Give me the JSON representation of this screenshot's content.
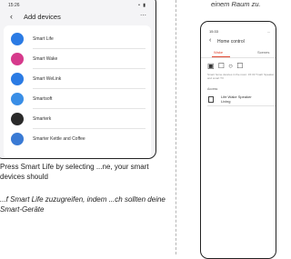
{
  "caption_top": "einem Raum zu.",
  "phone1": {
    "status_time": "15:26",
    "status_icons": "• ▮",
    "back_glyph": "‹",
    "title": "Add devices",
    "more_glyph": "⋯",
    "items": [
      {
        "label": "Smart Life",
        "color": "#2b7be4",
        "icon": "smart-life-icon"
      },
      {
        "label": "Smart Wake",
        "color": "#d63a8c",
        "icon": "smart-wake-icon"
      },
      {
        "label": "Smart WeLink",
        "color": "#2b7be4",
        "icon": "welink-icon"
      },
      {
        "label": "Smartsoft",
        "color": "#3a8ee6",
        "icon": "smartsoft-icon"
      },
      {
        "label": "Smarterk",
        "color": "#2a2a2a",
        "icon": "smarterk-icon"
      },
      {
        "label": "Smarter Kettle and Coffee",
        "color": "#3a7ad4",
        "icon": "kettle-icon"
      }
    ]
  },
  "caption_en": "Press Smart Life by selecting ...ne, your smart devices should",
  "caption_de": "...f Smart Life zuzugreifen, indem ...ch sollten deine Smart-Geräte",
  "phone2": {
    "status_time": "15:33",
    "status_icons": "...",
    "back_glyph": "‹",
    "title": "Home control",
    "tab_1": "Wake",
    "tab_2": "Scenes",
    "icons_row": "▣ ☐ ○ ☐",
    "note": "Smart home devices in the room: 15:33 Tmall: Speaker and smart TV",
    "section": "Access",
    "device_name_1": "Life Wake Speaker",
    "device_name_2": "Living"
  }
}
